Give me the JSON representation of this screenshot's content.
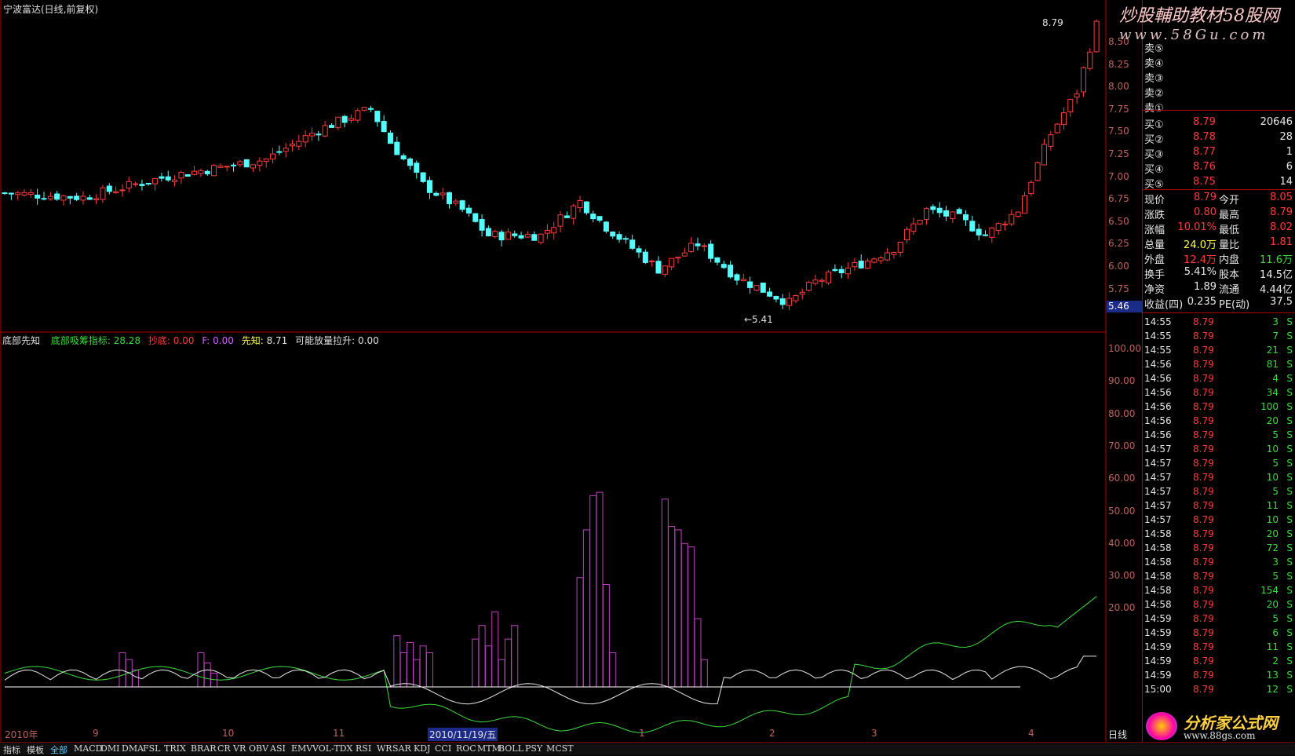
{
  "stock_title": "宁波富达(日线,前复权)",
  "high_marker": "8.79",
  "low_marker": "←5.41",
  "cross_price_tag": "5.46",
  "watermark_top": {
    "line1": "炒股輔助教材58股网",
    "line2": "www.58Gu.com"
  },
  "watermark_bottom": "分析家公式网",
  "watermark_bottom_url": "www.88gs.com",
  "indicator": {
    "name": "底部先知",
    "l1_label": "底部吸筹指标:",
    "l1_value": "28.28",
    "l2_label": "抄底:",
    "l2_value": "0.00",
    "l3_label": "F:",
    "l3_value": "0.00",
    "l4_label": "先知:",
    "l4_value": "8.71",
    "l5_label": "可能放量拉升:",
    "l5_value": "0.00"
  },
  "price_ticks": [
    "8.50",
    "8.25",
    "8.00",
    "7.75",
    "7.50",
    "7.25",
    "7.00",
    "6.75",
    "6.50",
    "6.25",
    "6.00",
    "5.75"
  ],
  "ind_ticks": [
    "100.00",
    "90.00",
    "80.00",
    "70.00",
    "60.00",
    "50.00",
    "40.00",
    "30.00",
    "20.00"
  ],
  "dates": [
    "2010年",
    "9",
    "10",
    "11",
    "2010/11/19/五",
    "1",
    "2",
    "3",
    "4",
    "日线"
  ],
  "bottom_tabs": [
    "指标",
    "模板",
    "全部",
    "MACD",
    "DMI",
    "DMA",
    "FSL",
    "TRIX",
    "BRAR",
    "CR",
    "VR",
    "OBV",
    "ASI",
    "EMV",
    "VOL-TDX",
    "RSI",
    "WR",
    "SAR",
    "KDJ",
    "CCI",
    "ROC",
    "MTM",
    "BOLL",
    "PSY",
    "MCST"
  ],
  "order_book": {
    "sell": [
      {
        "label": "卖⑤"
      },
      {
        "label": "卖④"
      },
      {
        "label": "卖③"
      },
      {
        "label": "卖②"
      },
      {
        "label": "卖①"
      }
    ],
    "buy": [
      {
        "label": "买①",
        "price": "8.79",
        "vol": "20646"
      },
      {
        "label": "买②",
        "price": "8.78",
        "vol": "28"
      },
      {
        "label": "买③",
        "price": "8.77",
        "vol": "1"
      },
      {
        "label": "买④",
        "price": "8.76",
        "vol": "6"
      },
      {
        "label": "买⑤",
        "price": "8.75",
        "vol": "14"
      }
    ]
  },
  "quote": [
    {
      "l1": "现价",
      "v1": "8.79",
      "l2": "今开",
      "v2": "8.05",
      "c1": "red",
      "c2": "red"
    },
    {
      "l1": "涨跌",
      "v1": "0.80",
      "l2": "最高",
      "v2": "8.79",
      "c1": "red",
      "c2": "red"
    },
    {
      "l1": "涨幅",
      "v1": "10.01%",
      "l2": "最低",
      "v2": "8.02",
      "c1": "red",
      "c2": "red"
    },
    {
      "l1": "总量",
      "v1": "24.0万",
      "l2": "量比",
      "v2": "1.81",
      "c1": "yellow",
      "c2": "red"
    },
    {
      "l1": "外盘",
      "v1": "12.4万",
      "l2": "内盘",
      "v2": "11.6万",
      "c1": "red",
      "c2": "green"
    },
    {
      "l1": "换手",
      "v1": "5.41%",
      "l2": "股本",
      "v2": "14.5亿",
      "c1": "white",
      "c2": "white"
    },
    {
      "l1": "净资",
      "v1": "1.89",
      "l2": "流通",
      "v2": "4.44亿",
      "c1": "white",
      "c2": "white"
    },
    {
      "l1": "收益(四)",
      "v1": "0.235",
      "l2": "PE(动)",
      "v2": "37.5",
      "c1": "white",
      "c2": "white"
    }
  ],
  "ticks": [
    {
      "t": "14:55",
      "p": "8.79",
      "v": "3",
      "s": "S"
    },
    {
      "t": "14:55",
      "p": "8.79",
      "v": "7",
      "s": "S"
    },
    {
      "t": "14:55",
      "p": "8.79",
      "v": "21",
      "s": "S"
    },
    {
      "t": "14:56",
      "p": "8.79",
      "v": "81",
      "s": "S"
    },
    {
      "t": "14:56",
      "p": "8.79",
      "v": "4",
      "s": "S"
    },
    {
      "t": "14:56",
      "p": "8.79",
      "v": "34",
      "s": "S"
    },
    {
      "t": "14:56",
      "p": "8.79",
      "v": "100",
      "s": "S"
    },
    {
      "t": "14:56",
      "p": "8.79",
      "v": "20",
      "s": "S"
    },
    {
      "t": "14:56",
      "p": "8.79",
      "v": "5",
      "s": "S"
    },
    {
      "t": "14:57",
      "p": "8.79",
      "v": "10",
      "s": "S"
    },
    {
      "t": "14:57",
      "p": "8.79",
      "v": "5",
      "s": "S"
    },
    {
      "t": "14:57",
      "p": "8.79",
      "v": "10",
      "s": "S"
    },
    {
      "t": "14:57",
      "p": "8.79",
      "v": "5",
      "s": "S"
    },
    {
      "t": "14:57",
      "p": "8.79",
      "v": "11",
      "s": "S"
    },
    {
      "t": "14:57",
      "p": "8.79",
      "v": "10",
      "s": "S"
    },
    {
      "t": "14:58",
      "p": "8.79",
      "v": "20",
      "s": "S"
    },
    {
      "t": "14:58",
      "p": "8.79",
      "v": "72",
      "s": "S"
    },
    {
      "t": "14:58",
      "p": "8.79",
      "v": "3",
      "s": "S"
    },
    {
      "t": "14:58",
      "p": "8.79",
      "v": "5",
      "s": "S"
    },
    {
      "t": "14:58",
      "p": "8.79",
      "v": "154",
      "s": "S"
    },
    {
      "t": "14:58",
      "p": "8.79",
      "v": "20",
      "s": "S"
    },
    {
      "t": "14:59",
      "p": "8.79",
      "v": "5",
      "s": "S"
    },
    {
      "t": "14:59",
      "p": "8.79",
      "v": "6",
      "s": "S"
    },
    {
      "t": "14:59",
      "p": "8.79",
      "v": "11",
      "s": "S"
    },
    {
      "t": "14:59",
      "p": "8.79",
      "v": "2",
      "s": "S"
    },
    {
      "t": "14:59",
      "p": "8.79",
      "v": "13",
      "s": "S"
    },
    {
      "t": "15:00",
      "p": "8.79",
      "v": "12",
      "s": "S"
    }
  ],
  "chart_data": {
    "type": "candlestick",
    "price_range": [
      5.41,
      8.79
    ],
    "indicator_range": [
      0,
      100
    ],
    "last_close": 8.79,
    "period_low": 5.41,
    "period_high": 8.79
  }
}
